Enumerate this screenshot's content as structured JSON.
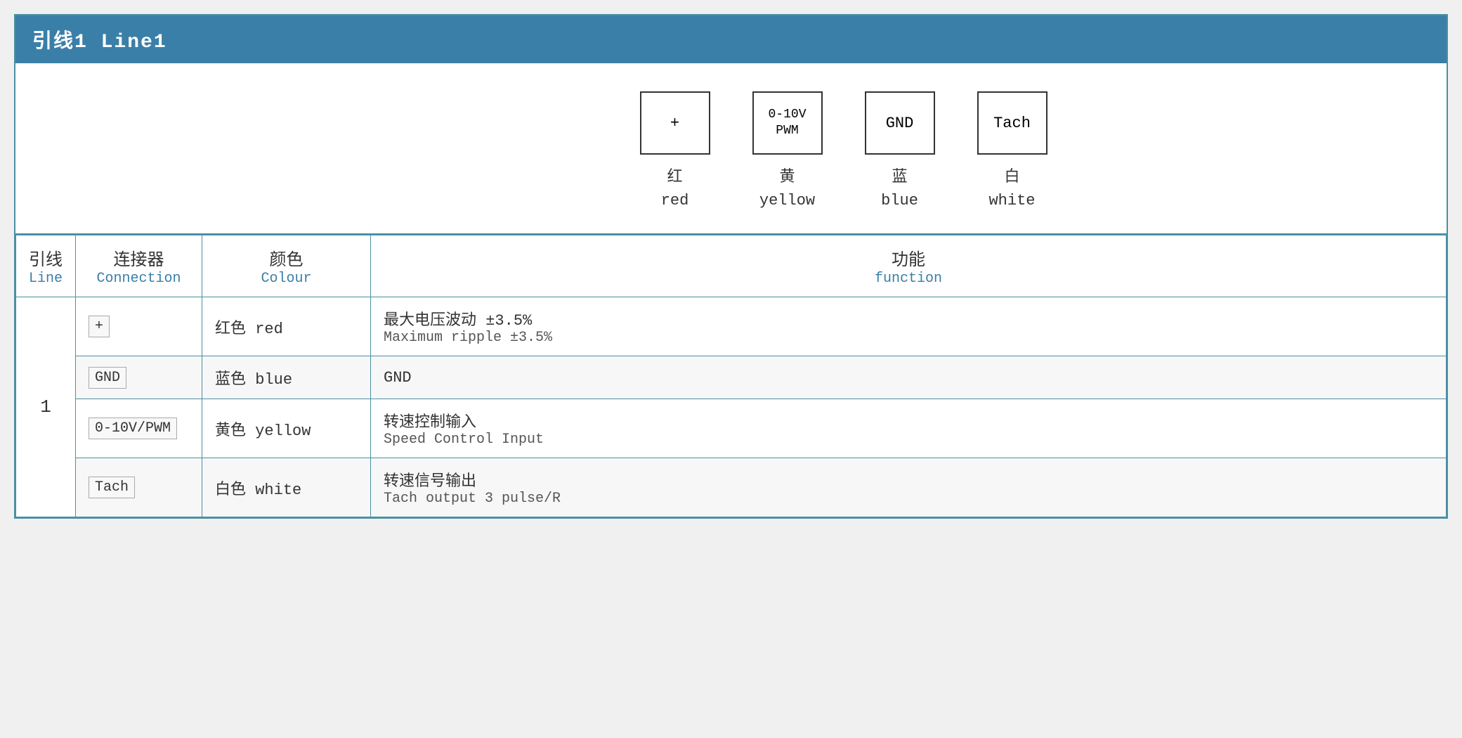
{
  "header": {
    "title": "引线1 Line1"
  },
  "diagram": {
    "connectors": [
      {
        "symbol": "+",
        "zh": "红",
        "en": "red"
      },
      {
        "symbol": "0-10V\nPWM",
        "zh": "黄",
        "en": "yellow"
      },
      {
        "symbol": "GND",
        "zh": "蓝",
        "en": "blue"
      },
      {
        "symbol": "Tach",
        "zh": "白",
        "en": "white"
      }
    ]
  },
  "table": {
    "headers": {
      "line_zh": "引线",
      "line_en": "Line",
      "connection_zh": "连接器",
      "connection_en": "Connection",
      "colour_zh": "颜色",
      "colour_en": "Colour",
      "function_zh": "功能",
      "function_en": "function"
    },
    "rows": [
      {
        "line": "1",
        "connection": "+",
        "colour_zh": "红色 red",
        "function_zh": "最大电压波动 ±3.5%",
        "function_en": "Maximum ripple ±3.5%"
      },
      {
        "line": "",
        "connection": "GND",
        "colour_zh": "蓝色 blue",
        "function_zh": "GND",
        "function_en": ""
      },
      {
        "line": "",
        "connection": "0-10V/PWM",
        "colour_zh": "黄色 yellow",
        "function_zh": "转速控制输入",
        "function_en": "Speed Control Input"
      },
      {
        "line": "",
        "connection": "Tach",
        "colour_zh": "白色 white",
        "function_zh": "转速信号输出",
        "function_en": "Tach output 3 pulse/R"
      }
    ]
  }
}
